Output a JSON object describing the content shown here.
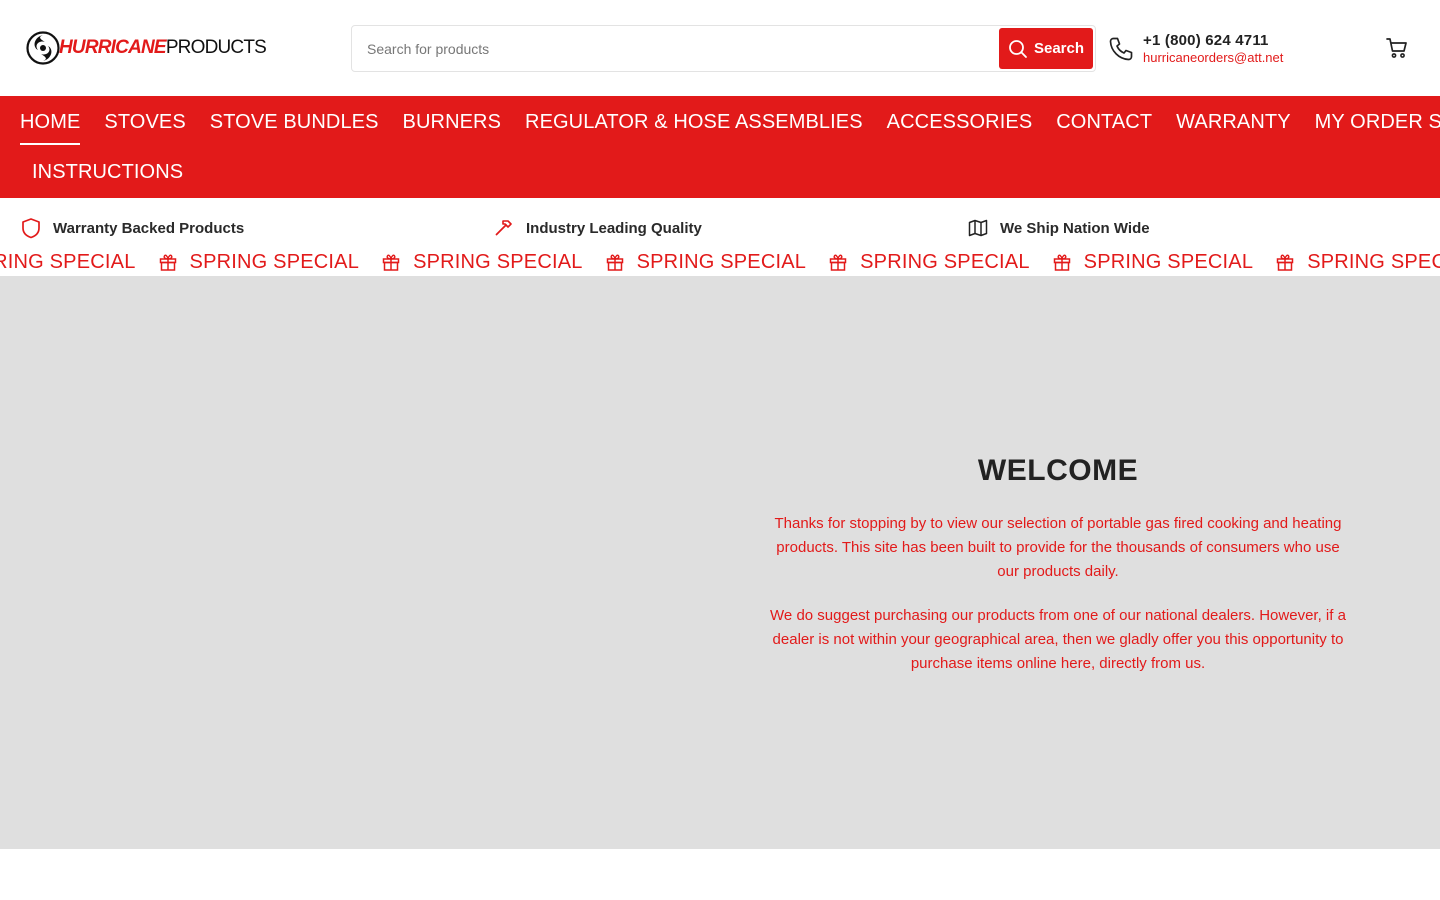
{
  "header": {
    "logo": {
      "brand": "HURRICANE",
      "rest": "PRODUCTS"
    },
    "search": {
      "placeholder": "Search for products",
      "button_label": "Search"
    },
    "contact": {
      "phone": "+1 (800) 624 4711",
      "email": "hurricaneorders@att.net"
    }
  },
  "nav": {
    "items": [
      {
        "label": "HOME"
      },
      {
        "label": "STOVES"
      },
      {
        "label": "STOVE BUNDLES"
      },
      {
        "label": "BURNERS"
      },
      {
        "label": "REGULATOR & HOSE ASSEMBLIES"
      },
      {
        "label": "ACCESSORIES"
      },
      {
        "label": "CONTACT"
      },
      {
        "label": "WARRANTY"
      },
      {
        "label": "MY ORDER STATUS"
      },
      {
        "label": "INSTRUCTIONS"
      }
    ],
    "active": "HOME"
  },
  "features": [
    {
      "icon": "shield-icon",
      "label": "Warranty Backed Products"
    },
    {
      "icon": "hammer-icon",
      "label": "Industry Leading Quality"
    },
    {
      "icon": "map-icon",
      "label": "We Ship Nation Wide"
    }
  ],
  "marquee": {
    "icon": "gift-icon",
    "items": [
      "SPRING SPECIAL",
      "SPRING SPECIAL",
      "SPRING SPECIAL",
      "SPRING SPECIAL",
      "SPRING SPECIAL",
      "SPRING SPECIAL",
      "SPRING SPECIAL",
      "SPRING SPECIAL"
    ]
  },
  "hero": {
    "title": "WELCOME",
    "paragraphs": [
      "Thanks for stopping by to view our selection of portable gas fired cooking and heating products. This site has been built to provide for the thousands of consumers who use our products daily.",
      "We do suggest purchasing our products from one of our national dealers. However, if a dealer is not within your geographical area, then we gladly offer you this opportunity to purchase items online here, directly from us."
    ]
  },
  "colors": {
    "accent": "#e21a1a",
    "hero_bg": "#dfdfdf",
    "text_dark": "#222222"
  }
}
